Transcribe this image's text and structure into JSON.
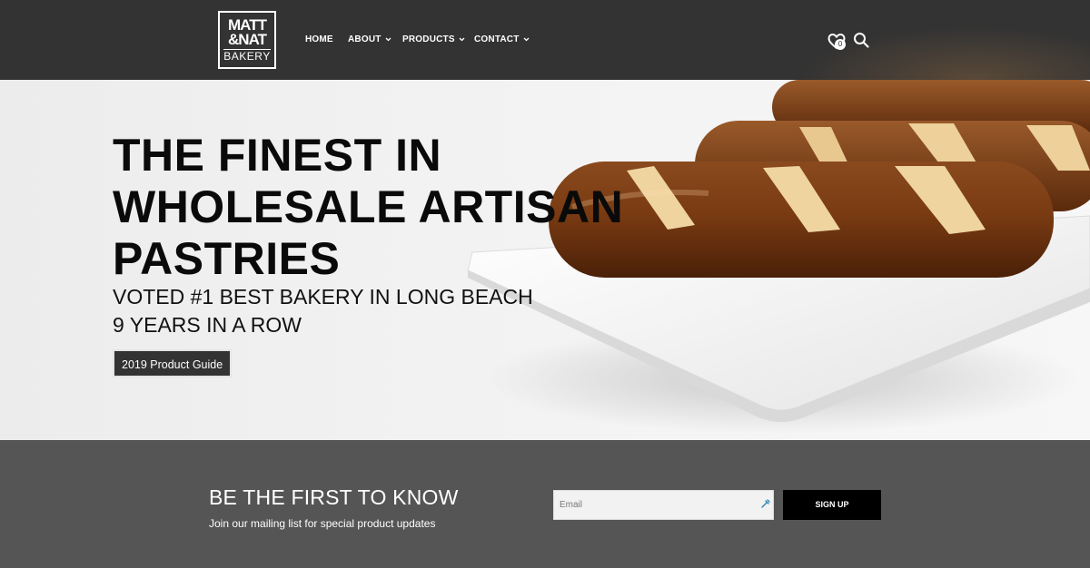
{
  "logo": {
    "line1": "MATT",
    "line2": "&NAT",
    "line3": "BAKERY"
  },
  "nav": {
    "home": "HOME",
    "about": "ABOUT",
    "products": "PRODUCTS",
    "contact": "CONTACT",
    "chevron": "⌄"
  },
  "header_icons": {
    "wishlist_icon": "heart-icon",
    "search_icon": "search-icon",
    "wishlist_count": "0"
  },
  "hero": {
    "title_line1": "THE FINEST IN",
    "title_line2": "WHOLESALE ARTISAN",
    "title_line3": "PASTRIES",
    "subtitle_line1": "VOTED #1 BEST BAKERY IN LONG BEACH",
    "subtitle_line2": "9 YEARS IN A ROW",
    "button_label": "2019 Product Guide"
  },
  "newsletter": {
    "title": "BE THE FIRST TO KNOW",
    "subtitle": "Join our mailing list for special product updates",
    "email_placeholder": "Email",
    "signup_label": "SIGN UP"
  },
  "colors": {
    "header_bg": "#333333",
    "newsletter_bg": "#555555",
    "button_bg": "#333333",
    "signup_bg": "#000000",
    "hero_text": "#0a0a0a"
  }
}
